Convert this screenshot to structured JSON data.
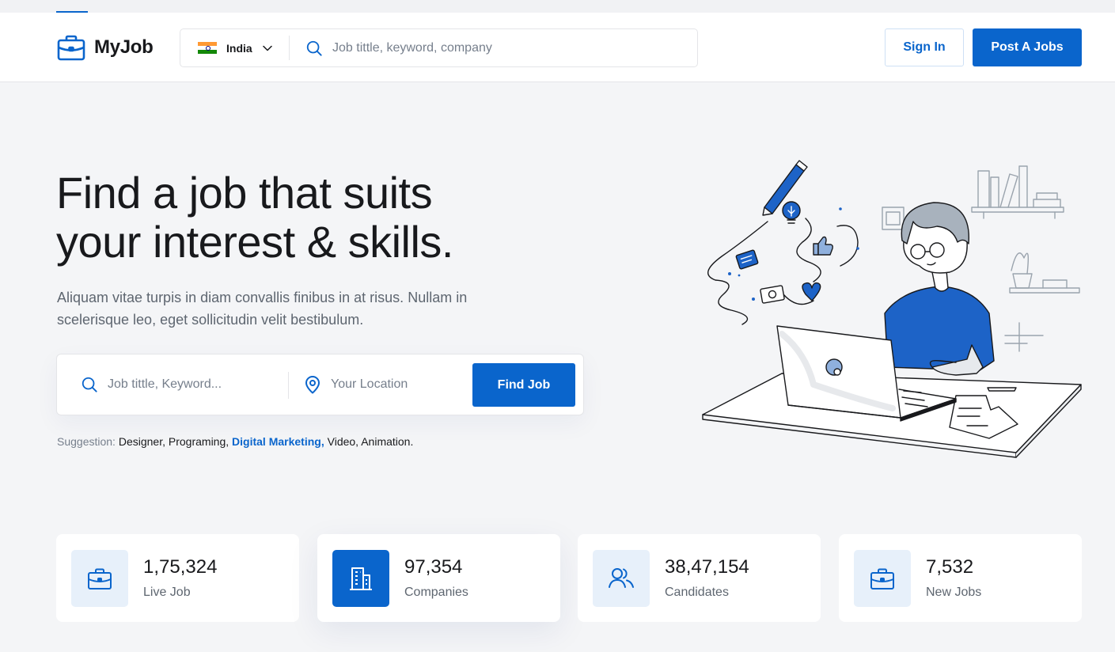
{
  "brand": {
    "name": "MyJob",
    "accent": "#0a65cc"
  },
  "header": {
    "country": "India",
    "search_placeholder": "Job tittle, keyword, company",
    "signin_label": "Sign In",
    "post_label": "Post A Jobs"
  },
  "hero": {
    "title_line1": "Find a job that suits",
    "title_line2": "your interest & skills.",
    "subtitle": "Aliquam vitae turpis in diam convallis finibus in at risus. Nullam in scelerisque leo, eget sollicitudin velit bestibulum."
  },
  "find": {
    "keyword_placeholder": "Job tittle, Keyword...",
    "location_placeholder": "Your Location",
    "button_label": "Find Job"
  },
  "suggestion": {
    "label": "Suggestion:",
    "items": [
      "Designer,",
      "Programing,",
      "Digital Marketing,",
      "Video,",
      "Animation."
    ],
    "highlighted": "Digital Marketing,"
  },
  "stats": [
    {
      "value": "1,75,324",
      "label": "Live Job",
      "icon": "briefcase-icon"
    },
    {
      "value": "97,354",
      "label": "Companies",
      "icon": "building-icon"
    },
    {
      "value": "38,47,154",
      "label": "Candidates",
      "icon": "users-icon"
    },
    {
      "value": "7,532",
      "label": "New Jobs",
      "icon": "briefcase-icon"
    }
  ]
}
